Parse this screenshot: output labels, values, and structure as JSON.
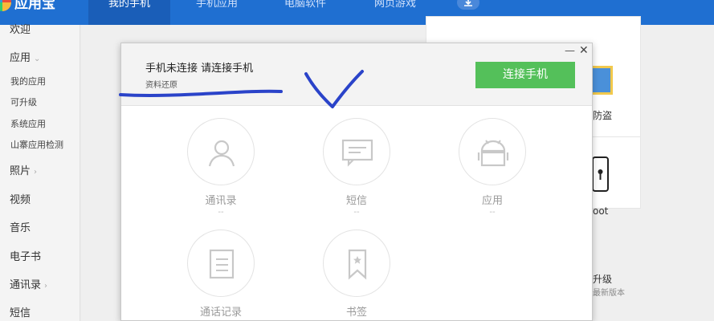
{
  "app": {
    "name": "应用宝"
  },
  "nav": {
    "tabs": [
      {
        "label": "我的手机",
        "active": true
      },
      {
        "label": "手机应用",
        "active": false
      },
      {
        "label": "电脑软件",
        "active": false
      },
      {
        "label": "网页游戏",
        "active": false
      }
    ]
  },
  "sidebar": {
    "welcome": "欢迎",
    "apps": "应用",
    "my_apps": "我的应用",
    "upgradable": "可升级",
    "system_apps": "系统应用",
    "fake_app_check": "山寨应用检测",
    "photos": "照片",
    "videos": "视频",
    "music": "音乐",
    "ebooks": "电子书",
    "contacts": "通讯录",
    "sms": "短信"
  },
  "background": {
    "antitheft_tail": "防盗",
    "root_tail": "oot",
    "upgrade_tail": "升级",
    "latest_version_tail": "最新版本"
  },
  "dialog": {
    "title": "手机未连接 请连接手机",
    "subtitle": "资料还原",
    "connect_button": "连接手机",
    "minimize": "—",
    "close": "✕",
    "features": [
      {
        "label": "通讯录",
        "count": "--",
        "icon": "contact-icon"
      },
      {
        "label": "短信",
        "count": "--",
        "icon": "message-icon"
      },
      {
        "label": "应用",
        "count": "--",
        "icon": "android-icon"
      },
      {
        "label": "通话记录",
        "count": "",
        "icon": "call-log-icon"
      },
      {
        "label": "书签",
        "count": "",
        "icon": "bookmark-icon"
      }
    ]
  },
  "colors": {
    "topbar": "#1f6fd1",
    "connect_button": "#54c05a",
    "annotation": "#2a43c9"
  }
}
